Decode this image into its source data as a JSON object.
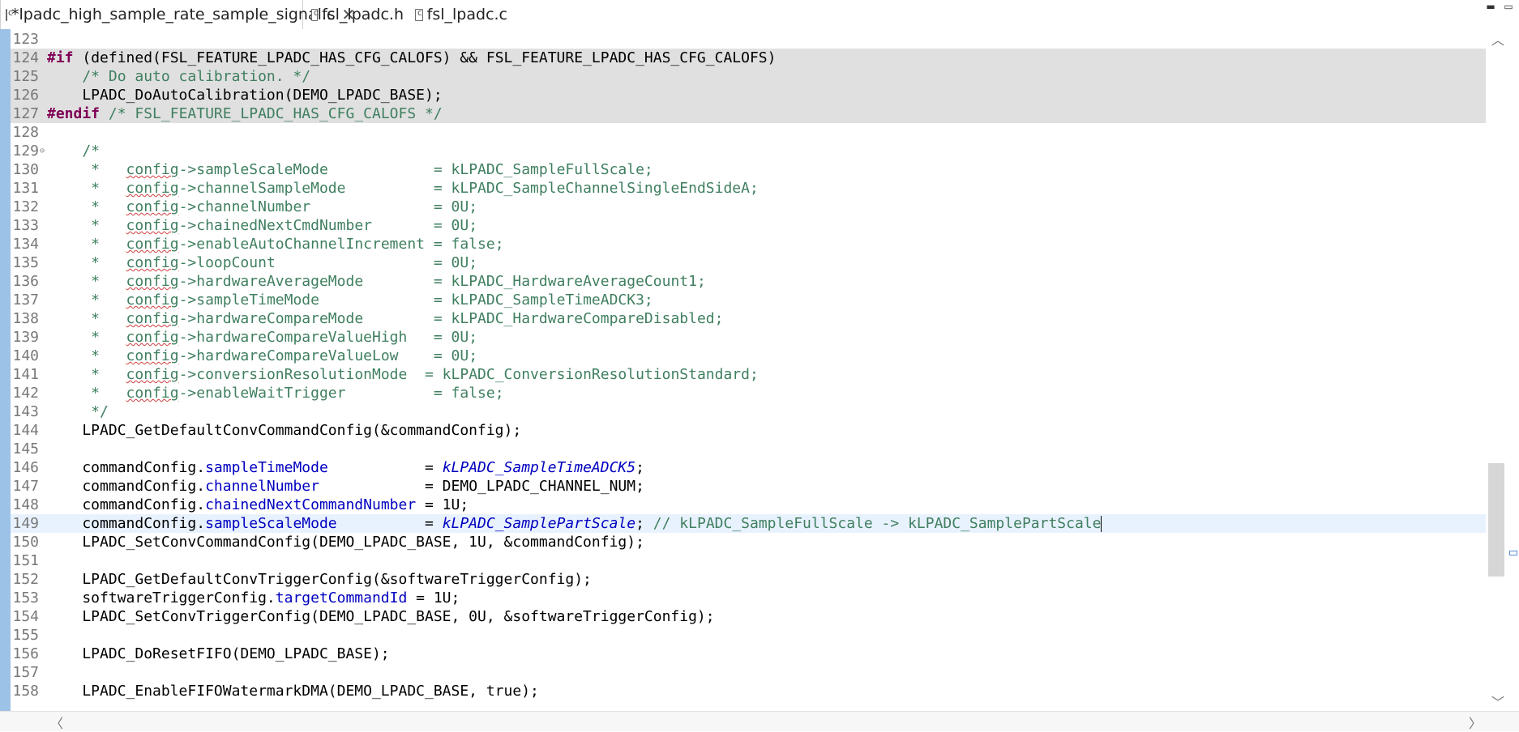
{
  "tabs": [
    {
      "label": "*lpadc_high_sample_rate_sample_signal.c",
      "active": true,
      "close": "✕"
    },
    {
      "label": "fsl_lpadc.h",
      "active": false
    },
    {
      "label": "fsl_lpadc.c",
      "active": false
    }
  ],
  "window_controls": {
    "minimize": "▬",
    "maximize": "▭"
  },
  "colors": {
    "keyword": "#7f0055",
    "comment": "#3f7f5f",
    "field": "#0000c0",
    "highlight": "#e0e0e0",
    "current_line": "#e8f2fe"
  },
  "lines": [
    {
      "num": "123",
      "segs": []
    },
    {
      "num": "124",
      "segs": [
        {
          "t": "#if",
          "c": "kw"
        },
        {
          "t": " (defined(FSL_FEATURE_LPADC_HAS_CFG_CALOFS) && FSL_FEATURE_LPADC_HAS_CFG_CALOFS)",
          "c": ""
        }
      ],
      "hl": true
    },
    {
      "num": "125",
      "segs": [
        {
          "t": "    /* Do auto calibration. */",
          "c": "cm"
        }
      ],
      "hl": true
    },
    {
      "num": "126",
      "segs": [
        {
          "t": "    LPADC_DoAutoCalibration(DEMO_LPADC_BASE);",
          "c": ""
        }
      ],
      "hl": true
    },
    {
      "num": "127",
      "segs": [
        {
          "t": "#endif",
          "c": "kw"
        },
        {
          "t": " /* FSL_FEATURE_LPADC_HAS_CFG_CALOFS */",
          "c": "cm"
        }
      ],
      "hl": true
    },
    {
      "num": "128",
      "segs": []
    },
    {
      "num": "129",
      "fold": "⊖",
      "segs": [
        {
          "t": "    /*",
          "c": "cm"
        }
      ]
    },
    {
      "num": "130",
      "segs": [
        {
          "t": "     *   ",
          "c": "cm"
        },
        {
          "t": "config",
          "c": "cm sq"
        },
        {
          "t": "->sampleScaleMode            = kLPADC_SampleFullScale;",
          "c": "cm"
        }
      ]
    },
    {
      "num": "131",
      "segs": [
        {
          "t": "     *   ",
          "c": "cm"
        },
        {
          "t": "config",
          "c": "cm sq"
        },
        {
          "t": "->channelSampleMode          = kLPADC_SampleChannelSingleEndSideA;",
          "c": "cm"
        }
      ]
    },
    {
      "num": "132",
      "segs": [
        {
          "t": "     *   ",
          "c": "cm"
        },
        {
          "t": "config",
          "c": "cm sq"
        },
        {
          "t": "->channelNumber              = 0U;",
          "c": "cm"
        }
      ]
    },
    {
      "num": "133",
      "segs": [
        {
          "t": "     *   ",
          "c": "cm"
        },
        {
          "t": "config",
          "c": "cm sq"
        },
        {
          "t": "->chainedNextCmdNumber       = 0U;",
          "c": "cm"
        }
      ]
    },
    {
      "num": "134",
      "segs": [
        {
          "t": "     *   ",
          "c": "cm"
        },
        {
          "t": "config",
          "c": "cm sq"
        },
        {
          "t": "->enableAutoChannelIncrement = false;",
          "c": "cm"
        }
      ]
    },
    {
      "num": "135",
      "segs": [
        {
          "t": "     *   ",
          "c": "cm"
        },
        {
          "t": "config",
          "c": "cm sq"
        },
        {
          "t": "->loopCount                  = 0U;",
          "c": "cm"
        }
      ]
    },
    {
      "num": "136",
      "segs": [
        {
          "t": "     *   ",
          "c": "cm"
        },
        {
          "t": "config",
          "c": "cm sq"
        },
        {
          "t": "->hardwareAverageMode        = kLPADC_HardwareAverageCount1;",
          "c": "cm"
        }
      ]
    },
    {
      "num": "137",
      "segs": [
        {
          "t": "     *   ",
          "c": "cm"
        },
        {
          "t": "config",
          "c": "cm sq"
        },
        {
          "t": "->sampleTimeMode             = kLPADC_SampleTimeADCK3;",
          "c": "cm"
        }
      ]
    },
    {
      "num": "138",
      "segs": [
        {
          "t": "     *   ",
          "c": "cm"
        },
        {
          "t": "config",
          "c": "cm sq"
        },
        {
          "t": "->hardwareCompareMode        = kLPADC_HardwareCompareDisabled;",
          "c": "cm"
        }
      ]
    },
    {
      "num": "139",
      "segs": [
        {
          "t": "     *   ",
          "c": "cm"
        },
        {
          "t": "config",
          "c": "cm sq"
        },
        {
          "t": "->hardwareCompareValueHigh   = 0U;",
          "c": "cm"
        }
      ]
    },
    {
      "num": "140",
      "segs": [
        {
          "t": "     *   ",
          "c": "cm"
        },
        {
          "t": "config",
          "c": "cm sq"
        },
        {
          "t": "->hardwareCompareValueLow    = 0U;",
          "c": "cm"
        }
      ]
    },
    {
      "num": "141",
      "segs": [
        {
          "t": "     *   ",
          "c": "cm"
        },
        {
          "t": "config",
          "c": "cm sq"
        },
        {
          "t": "->conversionResolutionMode  = kLPADC_ConversionResolutionStandard;",
          "c": "cm"
        }
      ]
    },
    {
      "num": "142",
      "segs": [
        {
          "t": "     *   ",
          "c": "cm"
        },
        {
          "t": "config",
          "c": "cm sq"
        },
        {
          "t": "->enableWaitTrigger          = false;",
          "c": "cm"
        }
      ]
    },
    {
      "num": "143",
      "segs": [
        {
          "t": "     */",
          "c": "cm"
        }
      ]
    },
    {
      "num": "144",
      "segs": [
        {
          "t": "    LPADC_GetDefaultConvCommandConfig(&commandConfig);",
          "c": ""
        }
      ]
    },
    {
      "num": "145",
      "segs": []
    },
    {
      "num": "146",
      "segs": [
        {
          "t": "    commandConfig.",
          "c": ""
        },
        {
          "t": "sampleTimeMode",
          "c": "fld"
        },
        {
          "t": "           = ",
          "c": ""
        },
        {
          "t": "kLPADC_SampleTimeADCK5",
          "c": "enm"
        },
        {
          "t": ";",
          "c": ""
        }
      ]
    },
    {
      "num": "147",
      "segs": [
        {
          "t": "    commandConfig.",
          "c": ""
        },
        {
          "t": "channelNumber",
          "c": "fld"
        },
        {
          "t": "            = DEMO_LPADC_CHANNEL_NUM;",
          "c": ""
        }
      ]
    },
    {
      "num": "148",
      "segs": [
        {
          "t": "    commandConfig.",
          "c": ""
        },
        {
          "t": "chainedNextCommandNumber",
          "c": "fld"
        },
        {
          "t": " = 1U;",
          "c": ""
        }
      ]
    },
    {
      "num": "149",
      "cur": true,
      "segs": [
        {
          "t": "    commandConfig.",
          "c": ""
        },
        {
          "t": "sampleScaleMode",
          "c": "fld"
        },
        {
          "t": "          = ",
          "c": ""
        },
        {
          "t": "kLPADC_SamplePartScale",
          "c": "enm"
        },
        {
          "t": "; ",
          "c": ""
        },
        {
          "t": "// kLPADC_SampleFullScale -> kLPADC_SamplePartScale",
          "c": "cm"
        }
      ]
    },
    {
      "num": "150",
      "segs": [
        {
          "t": "    LPADC_SetConvCommandConfig(DEMO_LPADC_BASE, 1U, &commandConfig);",
          "c": ""
        }
      ]
    },
    {
      "num": "151",
      "segs": []
    },
    {
      "num": "152",
      "segs": [
        {
          "t": "    LPADC_GetDefaultConvTriggerConfig(&softwareTriggerConfig);",
          "c": ""
        }
      ]
    },
    {
      "num": "153",
      "segs": [
        {
          "t": "    softwareTriggerConfig.",
          "c": ""
        },
        {
          "t": "targetCommandId",
          "c": "fld"
        },
        {
          "t": " = 1U;",
          "c": ""
        }
      ]
    },
    {
      "num": "154",
      "segs": [
        {
          "t": "    LPADC_SetConvTriggerConfig(DEMO_LPADC_BASE, 0U, &softwareTriggerConfig);",
          "c": ""
        }
      ]
    },
    {
      "num": "155",
      "segs": []
    },
    {
      "num": "156",
      "segs": [
        {
          "t": "    LPADC_DoResetFIFO(DEMO_LPADC_BASE);",
          "c": ""
        }
      ]
    },
    {
      "num": "157",
      "segs": []
    },
    {
      "num": "158",
      "segs": [
        {
          "t": "    LPADC_EnableFIFOWatermarkDMA(DEMO_LPADC_BASE, true);",
          "c": ""
        }
      ]
    }
  ]
}
